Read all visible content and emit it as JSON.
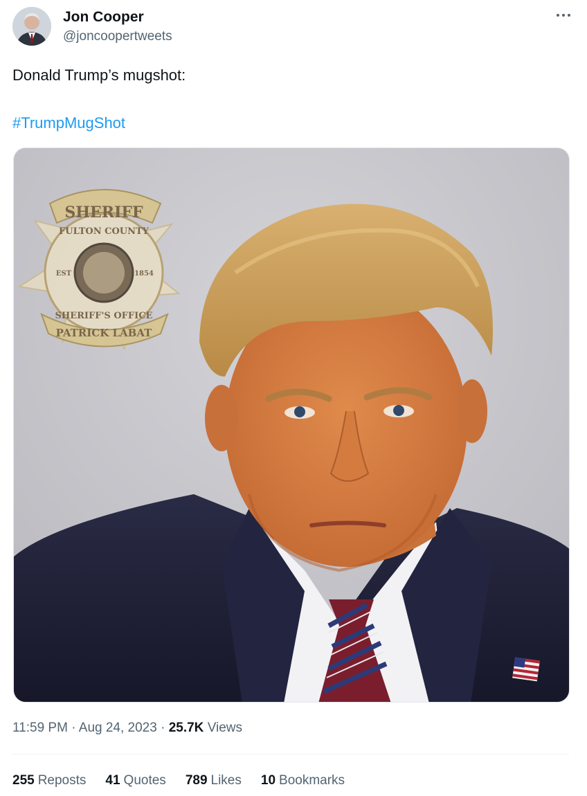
{
  "author": {
    "name": "Jon Cooper",
    "handle": "@joncoopertweets"
  },
  "tweet": {
    "text": "Donald Trump’s mugshot:",
    "hashtag": "#TrumpMugShot"
  },
  "media": {
    "badge": {
      "top": "SHERIFF",
      "ring_top": "FULTON COUNTY",
      "ring_bottom": "SHERIFF'S OFFICE",
      "bottom": "PATRICK LABAT",
      "est_left": "EST",
      "est_right": "1854"
    }
  },
  "meta": {
    "time": "11:59 PM",
    "date": "Aug 24, 2023",
    "views_count": "25.7K",
    "views_label": "Views"
  },
  "stats": {
    "reposts": {
      "count": "255",
      "label": "Reposts"
    },
    "quotes": {
      "count": "41",
      "label": "Quotes"
    },
    "likes": {
      "count": "789",
      "label": "Likes"
    },
    "bookmarks": {
      "count": "10",
      "label": "Bookmarks"
    }
  },
  "colors": {
    "link": "#1d9bf0",
    "secondary_text": "#536471",
    "primary_text": "#0f1419"
  },
  "icons": {
    "more": "more-horizontal-icon"
  }
}
